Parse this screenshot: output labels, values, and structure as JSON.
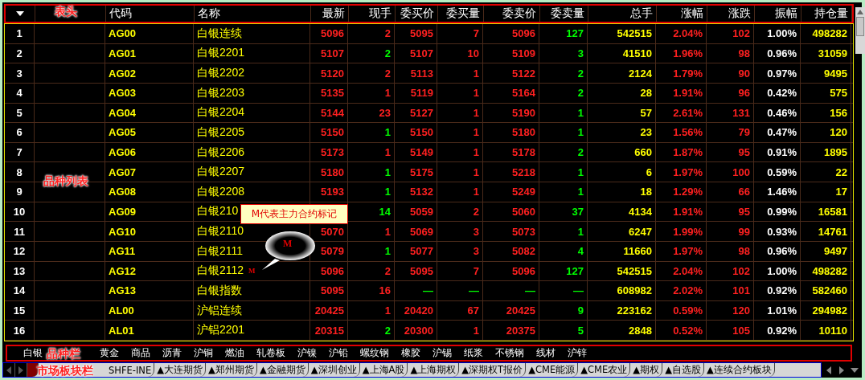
{
  "columns": [
    "代码",
    "名称",
    "最新",
    "现手",
    "委买价",
    "委买量",
    "委卖价",
    "委卖量",
    "总手",
    "涨幅",
    "涨跌",
    "振幅",
    "持仓量"
  ],
  "rows": [
    {
      "index": "1",
      "code": "AG00",
      "name": "白银连续",
      "last": "5096",
      "lot": "2",
      "buyer_initiated": true,
      "bid": "5095",
      "bid_size": "7",
      "ask": "5096",
      "ask_size": "127",
      "volume": "542515",
      "change_pct": "2.04%",
      "change": "102",
      "amplitude": "1.00%",
      "open_interest": "498282",
      "no_quotes": false
    },
    {
      "index": "2",
      "code": "AG01",
      "name": "白银2201",
      "last": "5107",
      "lot": "2",
      "buyer_initiated": false,
      "bid": "5107",
      "bid_size": "10",
      "ask": "5109",
      "ask_size": "3",
      "volume": "41510",
      "change_pct": "1.96%",
      "change": "98",
      "amplitude": "0.96%",
      "open_interest": "31059",
      "no_quotes": false
    },
    {
      "index": "3",
      "code": "AG02",
      "name": "白银2202",
      "last": "5120",
      "lot": "2",
      "buyer_initiated": true,
      "bid": "5113",
      "bid_size": "1",
      "ask": "5122",
      "ask_size": "2",
      "volume": "2124",
      "change_pct": "1.79%",
      "change": "90",
      "amplitude": "0.97%",
      "open_interest": "9495",
      "no_quotes": false
    },
    {
      "index": "4",
      "code": "AG03",
      "name": "白银2203",
      "last": "5135",
      "lot": "1",
      "buyer_initiated": true,
      "bid": "5119",
      "bid_size": "1",
      "ask": "5164",
      "ask_size": "2",
      "volume": "28",
      "change_pct": "1.91%",
      "change": "96",
      "amplitude": "0.42%",
      "open_interest": "575",
      "no_quotes": false
    },
    {
      "index": "5",
      "code": "AG04",
      "name": "白银2204",
      "last": "5144",
      "lot": "23",
      "buyer_initiated": true,
      "bid": "5127",
      "bid_size": "1",
      "ask": "5190",
      "ask_size": "1",
      "volume": "57",
      "change_pct": "2.61%",
      "change": "131",
      "amplitude": "0.46%",
      "open_interest": "156",
      "no_quotes": false
    },
    {
      "index": "6",
      "code": "AG05",
      "name": "白银2205",
      "last": "5150",
      "lot": "1",
      "buyer_initiated": false,
      "bid": "5150",
      "bid_size": "1",
      "ask": "5180",
      "ask_size": "1",
      "volume": "23",
      "change_pct": "1.56%",
      "change": "79",
      "amplitude": "0.47%",
      "open_interest": "120",
      "no_quotes": false
    },
    {
      "index": "7",
      "code": "AG06",
      "name": "白银2206",
      "last": "5173",
      "lot": "1",
      "buyer_initiated": true,
      "bid": "5149",
      "bid_size": "1",
      "ask": "5178",
      "ask_size": "2",
      "volume": "660",
      "change_pct": "1.87%",
      "change": "95",
      "amplitude": "0.91%",
      "open_interest": "1895",
      "no_quotes": false
    },
    {
      "index": "8",
      "code": "AG07",
      "name": "白银2207",
      "last": "5180",
      "lot": "1",
      "buyer_initiated": false,
      "bid": "5175",
      "bid_size": "1",
      "ask": "5218",
      "ask_size": "1",
      "volume": "6",
      "change_pct": "1.97%",
      "change": "100",
      "amplitude": "0.59%",
      "open_interest": "22",
      "no_quotes": false
    },
    {
      "index": "9",
      "code": "AG08",
      "name": "白银2208",
      "last": "5193",
      "lot": "1",
      "buyer_initiated": false,
      "bid": "5132",
      "bid_size": "1",
      "ask": "5249",
      "ask_size": "1",
      "volume": "18",
      "change_pct": "1.29%",
      "change": "66",
      "amplitude": "1.46%",
      "open_interest": "17",
      "no_quotes": false
    },
    {
      "index": "10",
      "code": "AG09",
      "name": "白银210",
      "lot": "14",
      "buyer_initiated": false,
      "bid": "5059",
      "bid_size": "2",
      "ask": "5060",
      "ask_size": "37",
      "volume": "4134",
      "change_pct": "1.91%",
      "change": "95",
      "amplitude": "0.99%",
      "open_interest": "16581",
      "no_quotes": false
    },
    {
      "index": "11",
      "code": "AG10",
      "name": "白银2110",
      "last": "5070",
      "lot": "1",
      "buyer_initiated": true,
      "bid": "5069",
      "bid_size": "3",
      "ask": "5073",
      "ask_size": "1",
      "volume": "6247",
      "change_pct": "1.99%",
      "change": "99",
      "amplitude": "0.93%",
      "open_interest": "14761",
      "no_quotes": false
    },
    {
      "index": "12",
      "code": "AG11",
      "name": "白银2111",
      "last": "5079",
      "lot": "1",
      "buyer_initiated": false,
      "bid": "5077",
      "bid_size": "3",
      "ask": "5082",
      "ask_size": "4",
      "volume": "11660",
      "change_pct": "1.97%",
      "change": "98",
      "amplitude": "0.96%",
      "open_interest": "9497",
      "no_quotes": false
    },
    {
      "index": "13",
      "code": "AG12",
      "name": "白银2112",
      "mark": "M",
      "last": "5096",
      "lot": "2",
      "buyer_initiated": true,
      "bid": "5095",
      "bid_size": "7",
      "ask": "5096",
      "ask_size": "127",
      "volume": "542515",
      "change_pct": "2.04%",
      "change": "102",
      "amplitude": "1.00%",
      "open_interest": "498282",
      "no_quotes": false
    },
    {
      "index": "14",
      "code": "AG13",
      "name": "白银指数",
      "last": "5095",
      "lot": "16",
      "buyer_initiated": true,
      "bid": "—",
      "bid_size": "—",
      "ask": "—",
      "ask_size": "—",
      "volume": "608982",
      "change_pct": "2.02%",
      "change": "101",
      "amplitude": "0.92%",
      "open_interest": "582460",
      "no_quotes": true
    },
    {
      "index": "15",
      "code": "AL00",
      "name": "沪铝连续",
      "last": "20425",
      "lot": "1",
      "buyer_initiated": true,
      "bid": "20420",
      "bid_size": "67",
      "ask": "20425",
      "ask_size": "9",
      "volume": "223162",
      "change_pct": "0.59%",
      "change": "120",
      "amplitude": "1.01%",
      "open_interest": "294982",
      "no_quotes": false
    },
    {
      "index": "16",
      "code": "AL01",
      "name": "沪铝2201",
      "last": "20315",
      "lot": "2",
      "buyer_initiated": false,
      "bid": "20300",
      "bid_size": "1",
      "ask": "20375",
      "ask_size": "5",
      "volume": "2848",
      "change_pct": "0.52%",
      "change": "105",
      "amplitude": "0.92%",
      "open_interest": "10110",
      "no_quotes": false
    }
  ],
  "tooltip": {
    "text": "M代表主力合约标记"
  },
  "callout": {
    "text": "M"
  },
  "categories": [
    "白银",
    "黄金",
    "商品",
    "沥青",
    "沪铜",
    "燃油",
    "轧卷板",
    "沪镍",
    "沪铅",
    "螺纹钢",
    "橡胶",
    "沪锡",
    "纸浆",
    "不锈钢",
    "线材",
    "沪锌"
  ],
  "market_tabs": [
    {
      "selected": true
    },
    {
      "label": "SHFE-INE",
      "selected": false
    },
    {
      "label": "▲大连期货",
      "selected": false
    },
    {
      "label": "▲郑州期货",
      "selected": false
    },
    {
      "label": "▲金融期货",
      "selected": false
    },
    {
      "label": "▲深圳创业",
      "selected": false
    },
    {
      "label": "▲上海A股",
      "selected": false
    },
    {
      "label": "▲上海期权",
      "selected": false
    },
    {
      "label": "▲深期权T报价",
      "selected": false
    },
    {
      "label": "▲CME能源",
      "selected": false
    },
    {
      "label": "▲CME农业",
      "selected": false
    },
    {
      "label": "▲期权",
      "selected": false
    },
    {
      "label": "▲自选股",
      "selected": false
    },
    {
      "label": "▲连续合约板块",
      "selected": false
    }
  ],
  "annotations": [
    {
      "kind": "header",
      "text": "表头"
    },
    {
      "kind": "list",
      "text": "品种列表"
    },
    {
      "kind": "category_bar",
      "text": "品种栏"
    },
    {
      "kind": "market_bar",
      "text": "市场板块栏"
    }
  ]
}
